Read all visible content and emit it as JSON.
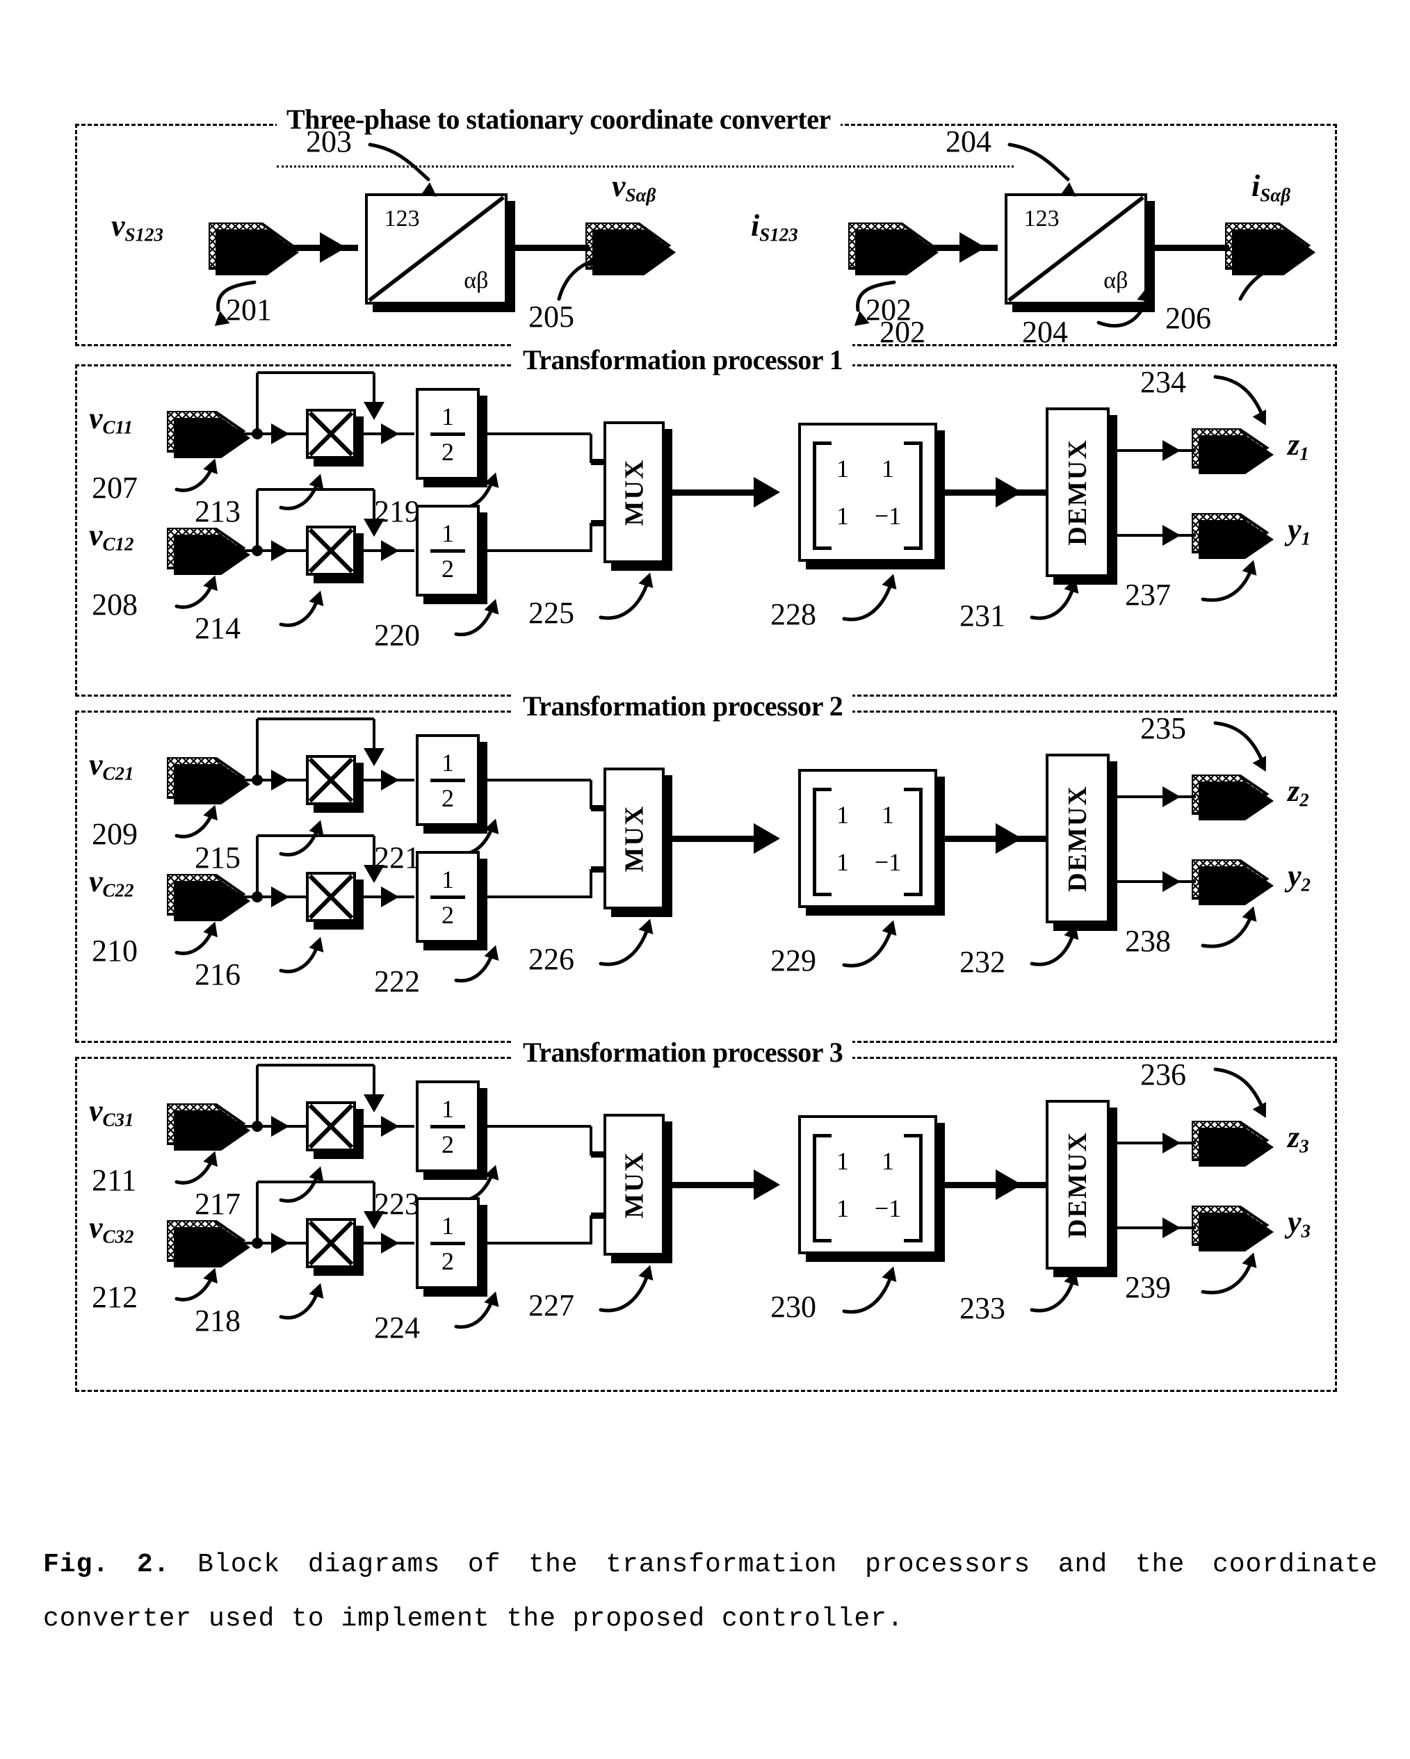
{
  "figure": {
    "caption_label": "Fig. 2.",
    "caption_text": "Block diagrams of the transformation processors and the coordinate converter used to implement the proposed controller."
  },
  "sections": [
    {
      "id": "converter",
      "title": "Three-phase to stationary coordinate converter"
    },
    {
      "id": "tp1",
      "title": "Transformation processor 1"
    },
    {
      "id": "tp2",
      "title": "Transformation processor 2"
    },
    {
      "id": "tp3",
      "title": "Transformation processor 3"
    }
  ],
  "converter": {
    "block_top_label": "123",
    "block_bottom_label": "αβ",
    "left": {
      "input_var": "v",
      "input_sub": "S123",
      "input_ref": "201",
      "block_ref": "203",
      "output_var": "v",
      "output_sub": "Sαβ",
      "output_ref": "205"
    },
    "right": {
      "input_var": "i",
      "input_sub": "S123",
      "input_ref": "202",
      "block_ref": "204",
      "output_var": "i",
      "output_sub": "Sαβ",
      "output_ref": "206"
    }
  },
  "gain": {
    "numerator": "1",
    "denominator": "2"
  },
  "mux_label": "MUX",
  "demux_label": "DEMUX",
  "matrix": {
    "r1c1": "1",
    "r1c2": "1",
    "r2c1": "1",
    "r2c2": "−1"
  },
  "processors": [
    {
      "id": "tp1",
      "title": "Transformation processor 1",
      "inputs": [
        {
          "var": "v",
          "sub": "C11",
          "ref": "207",
          "mult_ref": "213",
          "gain_ref": "219"
        },
        {
          "var": "v",
          "sub": "C12",
          "ref": "208",
          "mult_ref": "214",
          "gain_ref": "220"
        }
      ],
      "mux_ref": "225",
      "matrix_ref": "228",
      "demux_ref": "231",
      "outputs": [
        {
          "var": "z",
          "sub": "1",
          "ref": "234"
        },
        {
          "var": "y",
          "sub": "1",
          "ref": "237"
        }
      ]
    },
    {
      "id": "tp2",
      "title": "Transformation processor 2",
      "inputs": [
        {
          "var": "v",
          "sub": "C21",
          "ref": "209",
          "mult_ref": "215",
          "gain_ref": "221"
        },
        {
          "var": "v",
          "sub": "C22",
          "ref": "210",
          "mult_ref": "216",
          "gain_ref": "222"
        }
      ],
      "mux_ref": "226",
      "matrix_ref": "229",
      "demux_ref": "232",
      "outputs": [
        {
          "var": "z",
          "sub": "2",
          "ref": "235"
        },
        {
          "var": "y",
          "sub": "2",
          "ref": "238"
        }
      ]
    },
    {
      "id": "tp3",
      "title": "Transformation processor 3",
      "inputs": [
        {
          "var": "v",
          "sub": "C31",
          "ref": "211",
          "mult_ref": "217",
          "gain_ref": "223"
        },
        {
          "var": "v",
          "sub": "C32",
          "ref": "212",
          "mult_ref": "218",
          "gain_ref": "224"
        }
      ],
      "mux_ref": "227",
      "matrix_ref": "230",
      "demux_ref": "233",
      "outputs": [
        {
          "var": "z",
          "sub": "3",
          "ref": "236"
        },
        {
          "var": "y",
          "sub": "3",
          "ref": "239"
        }
      ]
    }
  ],
  "colors": {
    "ink": "#000000",
    "paper": "#ffffff"
  }
}
